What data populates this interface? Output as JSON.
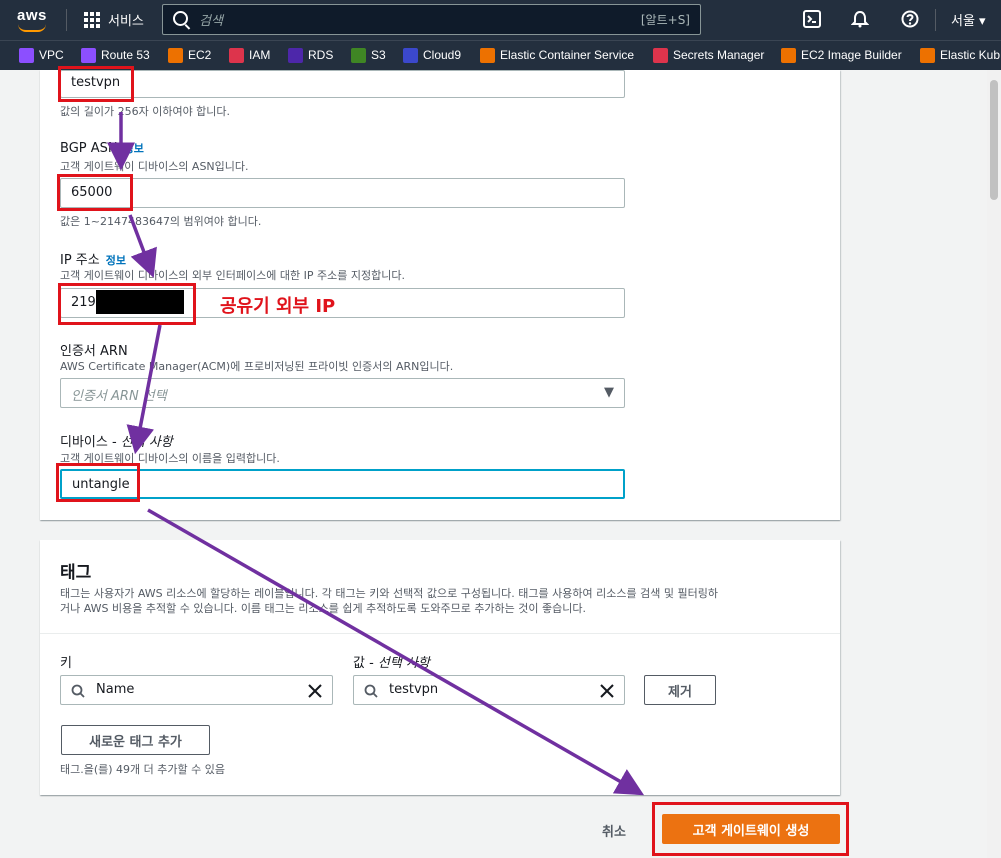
{
  "topbar": {
    "logo": "aws",
    "services_label": "서비스",
    "search_placeholder": "검색",
    "search_shortcut": "[알트+S]",
    "region": "서울"
  },
  "favorites": [
    "VPC",
    "Route 53",
    "EC2",
    "IAM",
    "RDS",
    "S3",
    "Cloud9",
    "Elastic Container Service",
    "Secrets Manager",
    "EC2 Image Builder",
    "Elastic Kub"
  ],
  "form": {
    "name_value": "testvpn",
    "name_hint": "값의 길이가 256자 이하여야 합니다.",
    "bgp_label": "BGP ASN",
    "info": "정보",
    "bgp_desc": "고객 게이트웨이 디바이스의 ASN입니다.",
    "bgp_value": "65000",
    "bgp_hint": "값은 1~2147483647의 범위여야 합니다.",
    "ip_label": "IP 주소",
    "ip_desc": "고객 게이트웨이 디바이스의 외부 인터페이스에 대한 IP 주소를 지정합니다.",
    "ip_value": "219",
    "ip_annotation": "공유기 외부 IP",
    "cert_label": "인증서 ARN",
    "cert_desc": "AWS Certificate Manager(ACM)에 프로비저닝된 프라이빗 인증서의 ARN입니다.",
    "cert_placeholder": "인증서 ARN 선택",
    "device_label": "디바이스 - ",
    "device_optional": "선택 사항",
    "device_desc": "고객 게이트웨이 디바이스의 이름을 입력합니다.",
    "device_value": "untangle"
  },
  "tags": {
    "title": "태그",
    "desc_line1": "태그는 사용자가 AWS 리소스에 할당하는 레이블입니다. 각 태그는 키와 선택적 값으로 구성됩니다. 태그를 사용하여 리소스를 검색 및 필터링하",
    "desc_line2": "거나 AWS 비용을 추적할 수 있습니다. 이름 태그는 리소스를 쉽게 추적하도록 도와주므로 추가하는 것이 좋습니다.",
    "key_label": "키",
    "value_label": "값 - ",
    "value_optional": "선택 사항",
    "key_value": "Name",
    "value_value": "testvpn",
    "remove_label": "제거",
    "add_label": "새로운 태그 추가",
    "remaining": "태그.을(를) 49개 더 추가할 수 있음"
  },
  "actions": {
    "cancel": "취소",
    "create": "고객 게이트웨이 생성"
  },
  "colors": {
    "annotation_red": "#e0131b",
    "arrow_purple": "#7030a0",
    "primary_orange": "#ec7211"
  }
}
